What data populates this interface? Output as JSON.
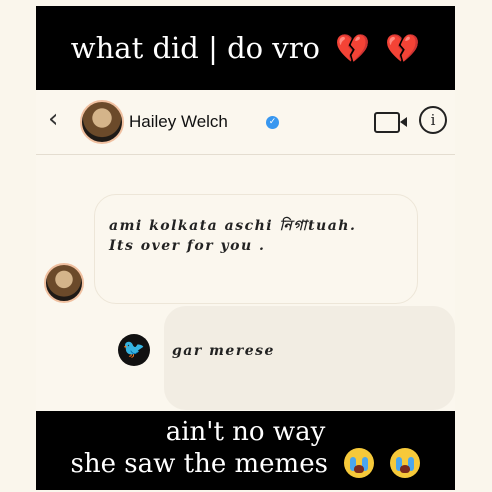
{
  "caption_top": {
    "text": "what did | do vro",
    "emoji": [
      "💔",
      "💔"
    ]
  },
  "header": {
    "back_icon": "‹",
    "name": "Hailey Welch",
    "verified_icon": "✓",
    "info_icon": "i"
  },
  "messages": [
    {
      "direction": "incoming",
      "lines": [
        "ami kolkata aschi নিগাtuah.",
        "Its over for you ."
      ]
    },
    {
      "direction": "outgoing",
      "text": "gar merese"
    }
  ],
  "app_icon": "🐦",
  "caption_bottom": {
    "line1": "ain't no way",
    "line2": "she saw the memes",
    "emoji": "😭"
  },
  "colors": {
    "caption_bg": "#000000",
    "caption_text": "#ffffff",
    "verified": "#3897f0",
    "heart": "#e3243b"
  }
}
